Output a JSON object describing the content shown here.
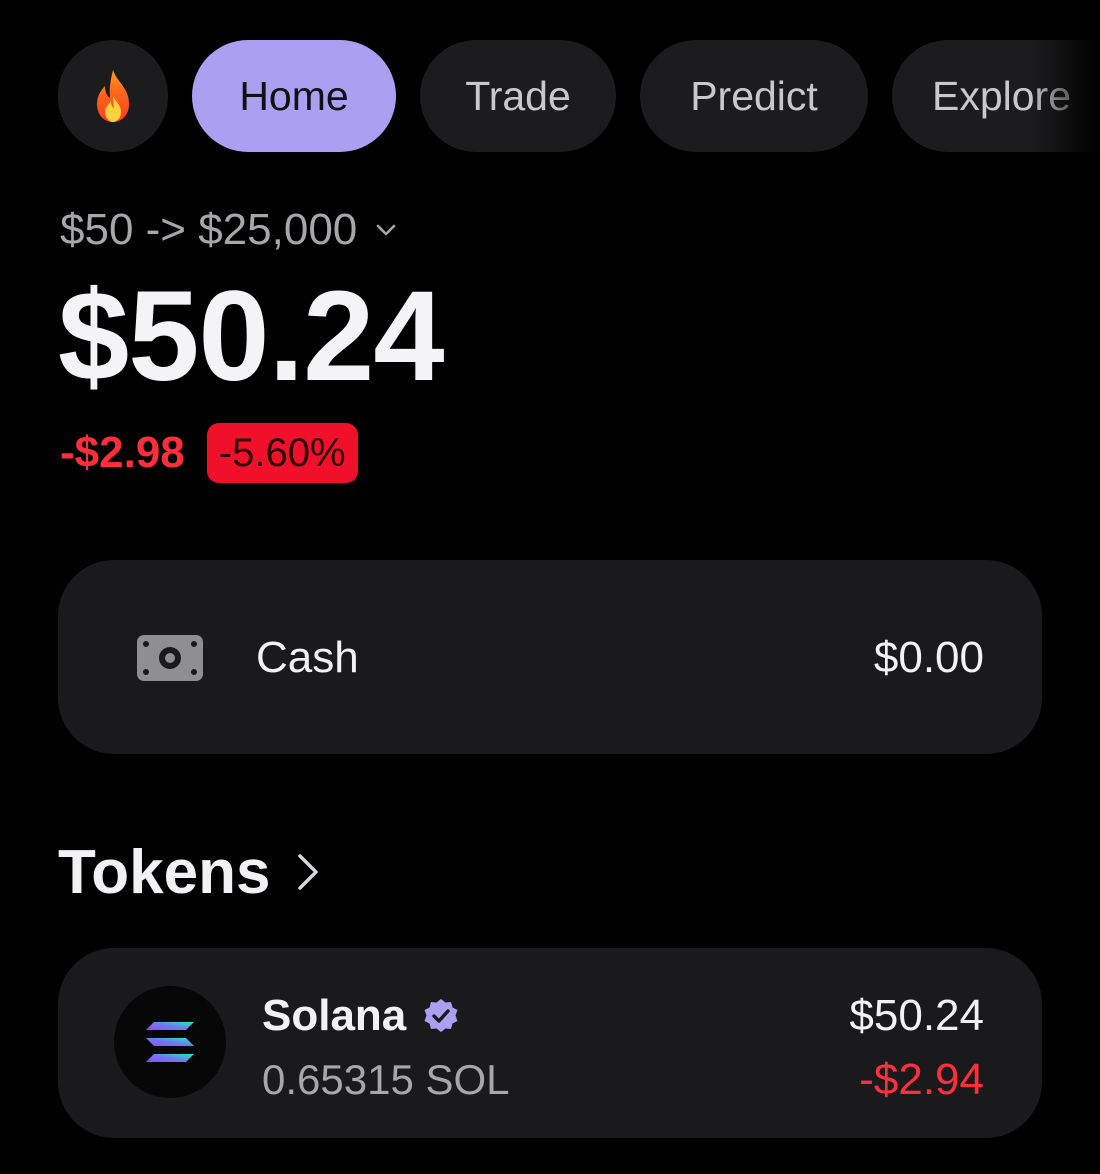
{
  "nav": {
    "fire_icon": "fire-icon",
    "tabs": [
      {
        "label": "Home",
        "active": true
      },
      {
        "label": "Trade",
        "active": false
      },
      {
        "label": "Predict",
        "active": false
      },
      {
        "label": "Explore",
        "active": false
      }
    ]
  },
  "portfolio": {
    "goal_label": "$50 -> $25,000",
    "balance": "$50.24",
    "change_abs": "-$2.98",
    "change_pct": "-5.60%"
  },
  "cash": {
    "icon": "cash-icon",
    "label": "Cash",
    "value": "$0.00"
  },
  "tokens": {
    "heading": "Tokens",
    "items": [
      {
        "name": "Solana",
        "amount": "0.65315 SOL",
        "value": "$50.24",
        "change": "-$2.94",
        "verified": true,
        "icon": "solana-logo-icon"
      }
    ]
  },
  "colors": {
    "background": "#000000",
    "card": "#1a1a1c",
    "accent": "#ab9ff2",
    "negative": "#ff2e3b",
    "negative_badge": "#f0102a",
    "muted_text": "#a6a6ab"
  }
}
